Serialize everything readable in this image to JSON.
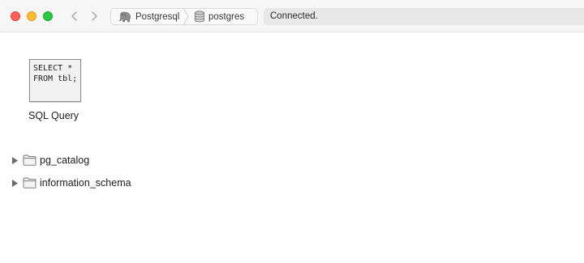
{
  "toolbar": {
    "breadcrumbs": [
      {
        "label": "Postgresql",
        "icon": "elephant-icon"
      },
      {
        "label": "postgres",
        "icon": "database-icon"
      }
    ],
    "status": "Connected."
  },
  "content": {
    "query_tile": {
      "preview_line1": "SELECT *",
      "preview_line2": "FROM tbl;",
      "label": "SQL Query"
    },
    "tree": [
      {
        "label": "pg_catalog",
        "icon": "folder-icon",
        "expanded": false
      },
      {
        "label": "information_schema",
        "icon": "folder-icon",
        "expanded": false
      }
    ]
  },
  "colors": {
    "close": "#ff5f57",
    "minimize": "#febc2e",
    "zoom": "#28c840"
  }
}
